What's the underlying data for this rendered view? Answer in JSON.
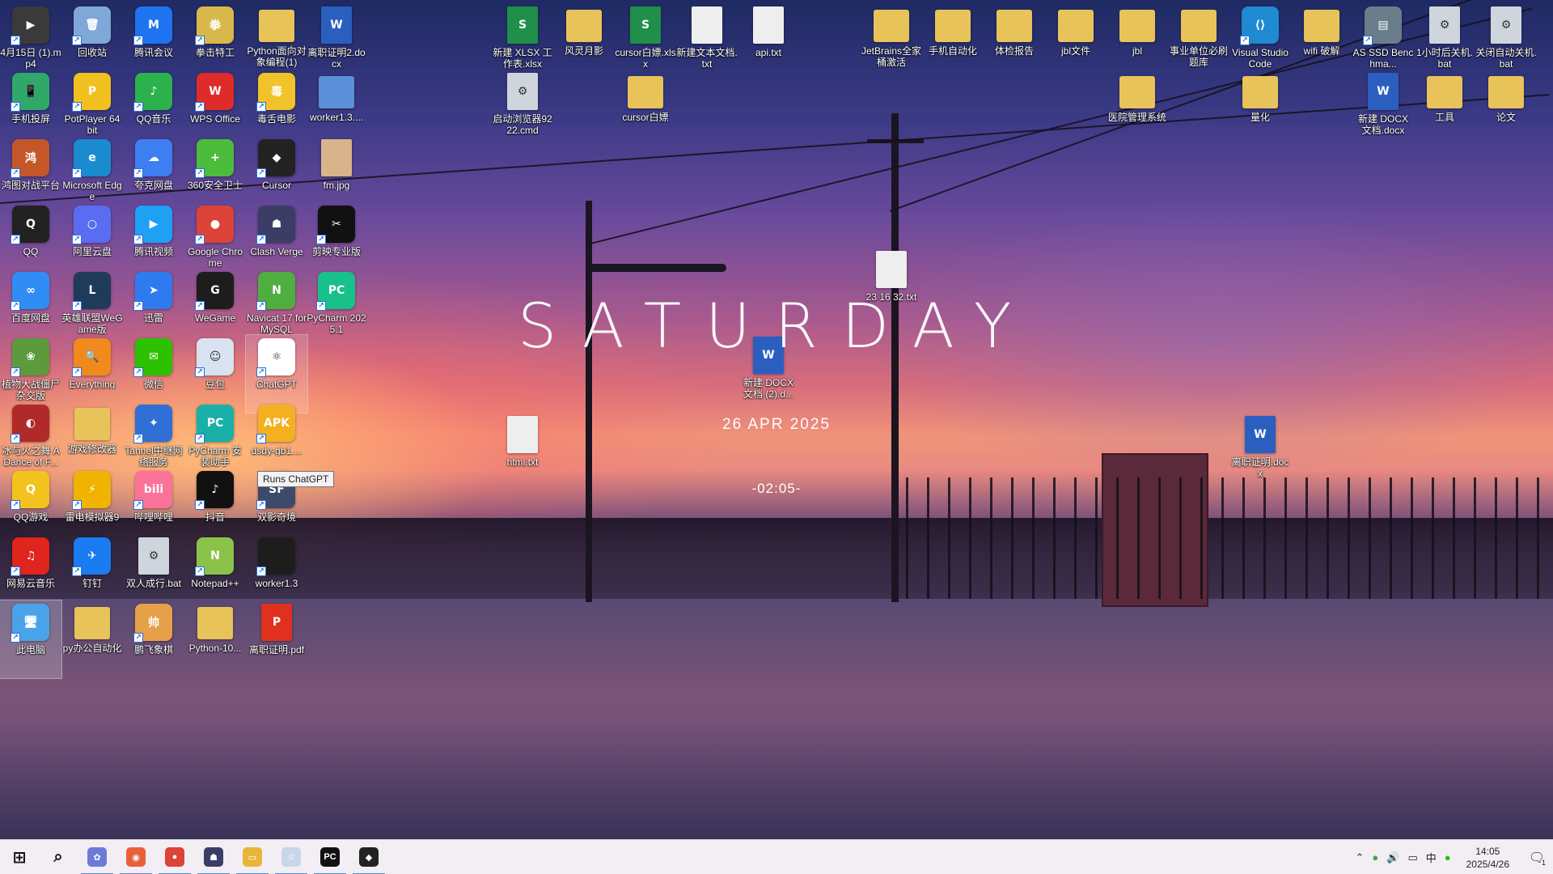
{
  "widget": {
    "day": "SATURDAY",
    "date": "26 APR 2025",
    "time": "-02:05-"
  },
  "tooltip": "Runs ChatGPT",
  "icons": [
    {
      "label": "4月15日 (1).mp4",
      "color": "#3a3a3a",
      "glyph": "▶",
      "kind": "app"
    },
    {
      "label": "回收站",
      "color": "#7fa7d8",
      "glyph": "🗑",
      "kind": "app"
    },
    {
      "label": "腾讯会议",
      "color": "#1e74f0",
      "glyph": "M",
      "kind": "app"
    },
    {
      "label": "拳击特工",
      "color": "#d8b84a",
      "glyph": "拳",
      "kind": "app"
    },
    {
      "label": "Python面向对象编程(1)",
      "color": "#e8c35a",
      "glyph": "",
      "kind": "folder"
    },
    {
      "label": "离职证明2.docx",
      "color": "#2b5fbf",
      "glyph": "W",
      "kind": "doc"
    },
    {
      "label": "手机投屏",
      "color": "#2fa86a",
      "glyph": "📱",
      "kind": "app"
    },
    {
      "label": "PotPlayer 64 bit",
      "color": "#f2c01e",
      "glyph": "P",
      "kind": "app"
    },
    {
      "label": "QQ音乐",
      "color": "#2bb24c",
      "glyph": "♪",
      "kind": "app"
    },
    {
      "label": "WPS Office",
      "color": "#e02b2b",
      "glyph": "W",
      "kind": "app"
    },
    {
      "label": "毒舌电影",
      "color": "#f1c22a",
      "glyph": "毒",
      "kind": "app"
    },
    {
      "label": "worker1.3....",
      "color": "#5b8fd8",
      "glyph": "",
      "kind": "folder"
    },
    {
      "label": "鸿图对战平台",
      "color": "#c4572a",
      "glyph": "鸿",
      "kind": "app"
    },
    {
      "label": "Microsoft Edge",
      "color": "#1b8bd0",
      "glyph": "e",
      "kind": "app"
    },
    {
      "label": "夸克网盘",
      "color": "#3d7ef0",
      "glyph": "☁",
      "kind": "app"
    },
    {
      "label": "360安全卫士",
      "color": "#4cbc3c",
      "glyph": "+",
      "kind": "app"
    },
    {
      "label": "Cursor",
      "color": "#222",
      "glyph": "◆",
      "kind": "app"
    },
    {
      "label": "fm.jpg",
      "color": "#d9b48a",
      "glyph": "",
      "kind": "doc"
    },
    {
      "label": "QQ",
      "color": "#222",
      "glyph": "Q",
      "kind": "app"
    },
    {
      "label": "阿里云盘",
      "color": "#5a6df0",
      "glyph": "○",
      "kind": "app"
    },
    {
      "label": "腾讯视频",
      "color": "#1ea0f5",
      "glyph": "▶",
      "kind": "app"
    },
    {
      "label": "Google Chrome",
      "color": "#db4437",
      "glyph": "●",
      "kind": "app"
    },
    {
      "label": "Clash Verge",
      "color": "#3b3d66",
      "glyph": "☗",
      "kind": "app"
    },
    {
      "label": "剪映专业版",
      "color": "#111",
      "glyph": "✂",
      "kind": "app"
    },
    {
      "label": "百度网盘",
      "color": "#2f8df5",
      "glyph": "∞",
      "kind": "app"
    },
    {
      "label": "英雄联盟WeGame版",
      "color": "#1f3b5a",
      "glyph": "L",
      "kind": "app"
    },
    {
      "label": "迅雷",
      "color": "#2e7bf0",
      "glyph": "➤",
      "kind": "app"
    },
    {
      "label": "WeGame",
      "color": "#1d1d1d",
      "glyph": "G",
      "kind": "app"
    },
    {
      "label": "Navicat 17 for MySQL",
      "color": "#4fae3f",
      "glyph": "N",
      "kind": "app"
    },
    {
      "label": "PyCharm 2025.1",
      "color": "#18c08a",
      "glyph": "PC",
      "kind": "app"
    },
    {
      "label": "植物大战僵尸杂交版",
      "color": "#5d9a3c",
      "glyph": "❀",
      "kind": "app"
    },
    {
      "label": "Everything",
      "color": "#f08a1c",
      "glyph": "🔍",
      "kind": "app"
    },
    {
      "label": "微信",
      "color": "#2dc100",
      "glyph": "✉",
      "kind": "app"
    },
    {
      "label": "豆包",
      "color": "#d8e2f0",
      "glyph": "☺",
      "kind": "app"
    },
    {
      "label": "ChatGPT",
      "color": "#ffffff",
      "glyph": "⚛",
      "kind": "app"
    },
    {
      "label": "冰与火之舞 A Dance of F...",
      "color": "#b02a2a",
      "glyph": "◐",
      "kind": "app"
    },
    {
      "label": "游戏修改器",
      "color": "#e8c35a",
      "glyph": "",
      "kind": "folder"
    },
    {
      "label": "Tannel中继网络服务",
      "color": "#2f6fd6",
      "glyph": "✦",
      "kind": "app"
    },
    {
      "label": "PyCharm 安装助手",
      "color": "#18b0a8",
      "glyph": "PC",
      "kind": "app"
    },
    {
      "label": "dsdy-gb1....",
      "color": "#f5b020",
      "glyph": "APK",
      "kind": "app"
    },
    {
      "label": "QQ游戏",
      "color": "#f2c31e",
      "glyph": "Q",
      "kind": "app"
    },
    {
      "label": "雷电模拟器9",
      "color": "#f0b400",
      "glyph": "⚡",
      "kind": "app"
    },
    {
      "label": "哔哩哔哩",
      "color": "#fb7299",
      "glyph": "bili",
      "kind": "app"
    },
    {
      "label": "抖音",
      "color": "#111",
      "glyph": "♪",
      "kind": "app"
    },
    {
      "label": "双影奇境",
      "color": "#3d4a6a",
      "glyph": "SF",
      "kind": "app"
    },
    {
      "label": "网易云音乐",
      "color": "#e0241e",
      "glyph": "♫",
      "kind": "app"
    },
    {
      "label": "钉钉",
      "color": "#1a7cf0",
      "glyph": "✈",
      "kind": "app"
    },
    {
      "label": "双人成行.bat",
      "color": "#cfd5dd",
      "glyph": "⚙",
      "kind": "doc"
    },
    {
      "label": "Notepad++",
      "color": "#8bc34a",
      "glyph": "N",
      "kind": "app"
    },
    {
      "label": "worker1.3",
      "color": "#1d1d1d",
      "glyph": "",
      "kind": "app"
    },
    {
      "label": "此电脑",
      "color": "#4aa3e8",
      "glyph": "🖥",
      "kind": "app"
    },
    {
      "label": "py办公自动化",
      "color": "#e8c35a",
      "glyph": "",
      "kind": "folder"
    },
    {
      "label": "鹏飞象棋",
      "color": "#e7a04a",
      "glyph": "帅",
      "kind": "app"
    },
    {
      "label": "Python-10...",
      "color": "#e8c35a",
      "glyph": "",
      "kind": "folder"
    },
    {
      "label": "离职证明.pdf",
      "color": "#e0301e",
      "glyph": "P",
      "kind": "doc"
    },
    {
      "label": "新建 XLSX 工作表.xlsx",
      "color": "#1f8f4a",
      "glyph": "S",
      "kind": "doc"
    },
    {
      "label": "风灵月影",
      "color": "#e8c35a",
      "glyph": "",
      "kind": "folder"
    },
    {
      "label": "cursor白嫖.xlsx",
      "color": "#1f8f4a",
      "glyph": "S",
      "kind": "doc"
    },
    {
      "label": "新建文本文档.txt",
      "color": "#eeeeee",
      "glyph": "",
      "kind": "doc"
    },
    {
      "label": "api.txt",
      "color": "#eeeeee",
      "glyph": "",
      "kind": "doc"
    },
    {
      "label": "启动浏览器9222.cmd",
      "color": "#cfd5dd",
      "glyph": "⚙",
      "kind": "doc"
    },
    {
      "label": "cursor白嫖",
      "color": "#e8c35a",
      "glyph": "",
      "kind": "folder"
    },
    {
      "label": "23 16 32.txt",
      "color": "#eeeeee",
      "glyph": "",
      "kind": "doc"
    },
    {
      "label": "新建 DOCX 文档 (2).d...",
      "color": "#2b5fbf",
      "glyph": "W",
      "kind": "doc"
    },
    {
      "label": "html.txt",
      "color": "#eeeeee",
      "glyph": "",
      "kind": "doc"
    },
    {
      "label": "JetBrains全家桶激活",
      "color": "#e8c35a",
      "glyph": "",
      "kind": "folder"
    },
    {
      "label": "手机自动化",
      "color": "#e8c35a",
      "glyph": "",
      "kind": "folder"
    },
    {
      "label": "体检报告",
      "color": "#e8c35a",
      "glyph": "",
      "kind": "folder"
    },
    {
      "label": "jbl文件",
      "color": "#e8c35a",
      "glyph": "",
      "kind": "folder"
    },
    {
      "label": "jbl",
      "color": "#e8c35a",
      "glyph": "",
      "kind": "folder"
    },
    {
      "label": "事业单位必刷题库",
      "color": "#e8c35a",
      "glyph": "",
      "kind": "folder"
    },
    {
      "label": "Visual Studio Code",
      "color": "#1f8ad2",
      "glyph": "⟨⟩",
      "kind": "app"
    },
    {
      "label": "wifi 破解",
      "color": "#e8c35a",
      "glyph": "",
      "kind": "folder"
    },
    {
      "label": "AS SSD Benchma...",
      "color": "#6a7d8a",
      "glyph": "▤",
      "kind": "app"
    },
    {
      "label": "1小时后关机.bat",
      "color": "#cfd5dd",
      "glyph": "⚙",
      "kind": "doc"
    },
    {
      "label": "关闭自动关机.bat",
      "color": "#cfd5dd",
      "glyph": "⚙",
      "kind": "doc"
    },
    {
      "label": "医院管理系统",
      "color": "#e8c35a",
      "glyph": "",
      "kind": "folder"
    },
    {
      "label": "量化",
      "color": "#e8c35a",
      "glyph": "",
      "kind": "folder"
    },
    {
      "label": "新建 DOCX 文档.docx",
      "color": "#2b5fbf",
      "glyph": "W",
      "kind": "doc"
    },
    {
      "label": "工具",
      "color": "#e8c35a",
      "glyph": "",
      "kind": "folder"
    },
    {
      "label": "论文",
      "color": "#e8c35a",
      "glyph": "",
      "kind": "folder"
    },
    {
      "label": "离职证明.docx",
      "color": "#2b5fbf",
      "glyph": "W",
      "kind": "doc"
    }
  ],
  "taskbar": {
    "items": [
      {
        "name": "start-button",
        "glyph": "⊞",
        "color": "#111"
      },
      {
        "name": "search-button",
        "glyph": "⌕",
        "color": "#111"
      },
      {
        "name": "taskbar-app-1",
        "glyph": "✿",
        "color": "#6c7bd8"
      },
      {
        "name": "taskbar-app-2",
        "glyph": "◉",
        "color": "#e8613a"
      },
      {
        "name": "taskbar-chrome",
        "glyph": "●",
        "color": "#db4437"
      },
      {
        "name": "taskbar-clash",
        "glyph": "☗",
        "color": "#3b3d66"
      },
      {
        "name": "taskbar-explorer",
        "glyph": "▭",
        "color": "#e8b53a"
      },
      {
        "name": "taskbar-doubao",
        "glyph": "☺",
        "color": "#c8d6ea"
      },
      {
        "name": "taskbar-pycharm",
        "glyph": "PC",
        "color": "#111"
      },
      {
        "name": "taskbar-cursor",
        "glyph": "◆",
        "color": "#222"
      }
    ],
    "tray": {
      "ime": "中",
      "clock_time": "14:05",
      "clock_date": "2025/4/26",
      "notifications": "1"
    }
  }
}
